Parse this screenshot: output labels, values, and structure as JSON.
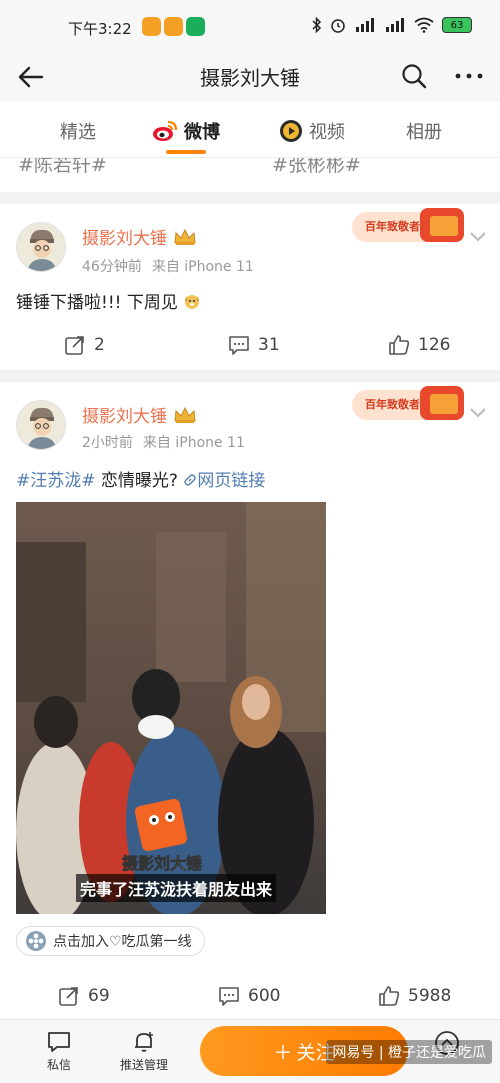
{
  "status_bar": {
    "time": "下午3:22",
    "battery": "63",
    "app_icon_colors": [
      "#f4a024",
      "#f4a024",
      "#1aad5c"
    ]
  },
  "topbar": {
    "title": "摄影刘大锤",
    "back_icon": "back-arrow-icon",
    "search_icon": "search-icon",
    "more_icon": "more-icon"
  },
  "tabs": [
    {
      "label": "精选",
      "icon": ""
    },
    {
      "label": "微博",
      "icon": "weibo-logo-icon",
      "active": true
    },
    {
      "label": "视频",
      "icon": "video-icon"
    },
    {
      "label": "相册",
      "icon": ""
    }
  ],
  "previous_tags": [
    "#陈若轩#",
    "#张彬彬#"
  ],
  "posts": [
    {
      "author": "摄影刘大锤",
      "time": "46分钟前",
      "source": "来自 iPhone 11",
      "badge_text": "百年致敬者",
      "text": "锤锤下播啦!!!  下周见",
      "reposts": "2",
      "comments": "31",
      "likes": "126"
    },
    {
      "author": "摄影刘大锤",
      "time": "2小时前",
      "source": "来自 iPhone 11",
      "badge_text": "百年致敬者",
      "topic": "#汪苏泷#",
      "text": " 恋情曝光?",
      "link_text": "网页链接",
      "photo_watermark": "摄影刘大锤",
      "photo_caption": "完事了汪苏泷扶着朋友出来",
      "chip_text": "点击加入♡吃瓜第一线",
      "reposts": "69",
      "comments": "600",
      "likes": "5988"
    }
  ],
  "bottom_bar": {
    "message_label": "私信",
    "push_label": "推送管理",
    "follow_label": "关注",
    "overlay_watermark": "网易号 | 橙子还是爱吃瓜"
  },
  "colors": {
    "accent": "#ff8200",
    "author_name": "#eb7350",
    "topic": "#507daf"
  }
}
